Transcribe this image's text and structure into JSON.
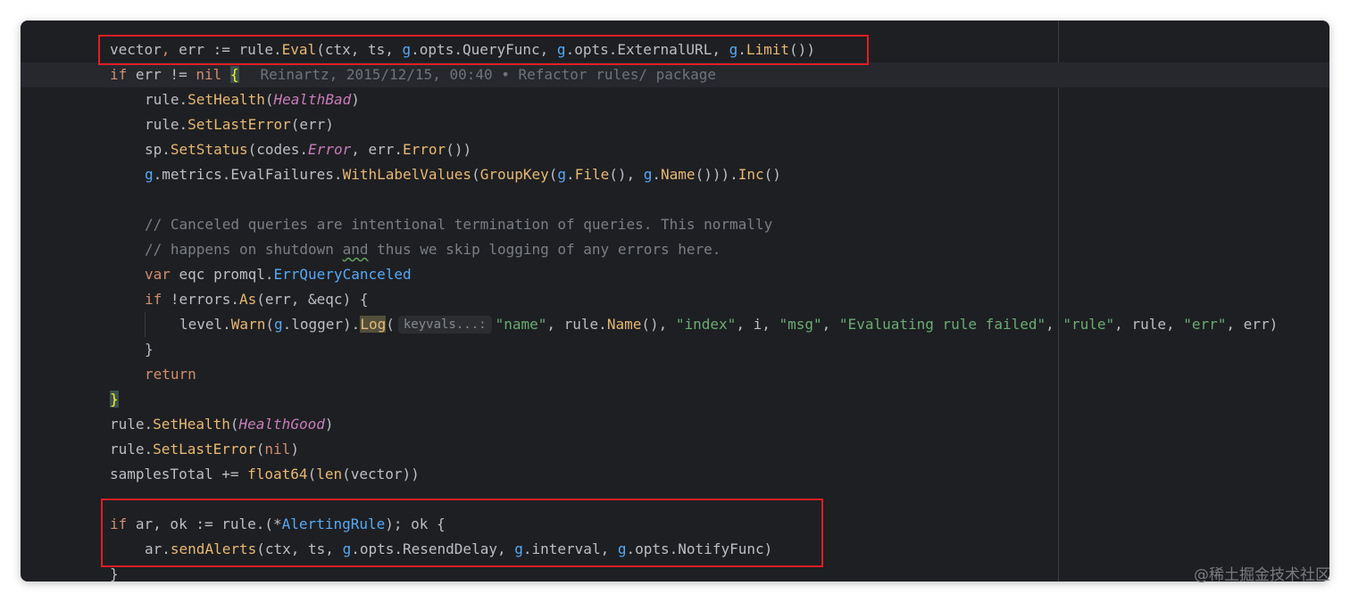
{
  "code": {
    "line1": {
      "t1": "vector",
      "t2": ", ",
      "t3": "err := rule.",
      "t4": "Eval",
      "t5": "(ctx, ts, ",
      "t6": "g",
      "t7": ".opts.QueryFunc, ",
      "t8": "g",
      "t9": ".opts.ExternalURL, ",
      "t10": "g",
      "t11": ".",
      "t12": "Limit",
      "t13": "())"
    },
    "line2": {
      "kw": "if",
      "t1": " err != ",
      "nil": "nil",
      "sp": " ",
      "brace": "{",
      "blame": "Reinartz, 2015/12/15, 00:40 • Refactor rules/ package"
    },
    "line3": {
      "t1": "rule.",
      "fn": "SetHealth",
      "t2": "(",
      "c": "HealthBad",
      "t3": ")"
    },
    "line4": {
      "t1": "rule.",
      "fn": "SetLastError",
      "t2": "(err)"
    },
    "line5": {
      "t1": "sp.",
      "fn": "SetStatus",
      "t2": "(codes.",
      "c": "Error",
      "t3": ", err.",
      "fn2": "Error",
      "t4": "())"
    },
    "line6": {
      "g1": "g",
      "t1": ".metrics.EvalFailures.",
      "fn": "WithLabelValues",
      "t2": "(",
      "fn2": "GroupKey",
      "t3": "(",
      "g2": "g",
      "t4": ".",
      "fn3": "File",
      "t5": "(), ",
      "g3": "g",
      "t6": ".",
      "fn4": "Name",
      "t7": "())).",
      "fn5": "Inc",
      "t8": "()"
    },
    "line8": {
      "cm": "// Canceled queries are intentional termination of queries. This normally"
    },
    "line9": {
      "cm1": "// happens on shutdown ",
      "cm2": "and",
      "cm3": " thus we skip logging of any errors here."
    },
    "line10": {
      "kw": "var",
      "t1": " eqc promql.",
      "fn": "ErrQueryCanceled"
    },
    "line11": {
      "kw": "if",
      "t1": " !errors.",
      "fn": "As",
      "t2": "(err, &eqc) {"
    },
    "line12": {
      "t1": "level.",
      "fn": "Warn",
      "t2": "(",
      "g1": "g",
      "t3": ".logger).",
      "log": "Log",
      "t4": "(",
      "hint": "keyvals...:",
      "s1": "\"name\"",
      "t5": ", rule.",
      "fn2": "Name",
      "t6": "(), ",
      "s2": "\"index\"",
      "t7": ", i, ",
      "s3": "\"msg\"",
      "t8": ", ",
      "s4": "\"Evaluating rule failed\"",
      "t9": ", ",
      "s5": "\"rule\"",
      "t10": ", rule, ",
      "s6": "\"err\"",
      "t11": ", err)"
    },
    "line13": {
      "t1": "}"
    },
    "line14": {
      "kw": "return"
    },
    "line15": {
      "brace": "}"
    },
    "line16": {
      "t1": "rule.",
      "fn": "SetHealth",
      "t2": "(",
      "c": "HealthGood",
      "t3": ")"
    },
    "line17": {
      "t1": "rule.",
      "fn": "SetLastError",
      "t2": "(",
      "nil": "nil",
      "t3": ")"
    },
    "line18": {
      "t1": "samplesTotal += ",
      "fn": "float64",
      "t2": "(",
      "fn2": "len",
      "t3": "(vector))"
    },
    "line20": {
      "kw": "if",
      "t1": " ar, ok := rule.(*",
      "iface": "AlertingRule",
      "t2": "); ok {"
    },
    "line21": {
      "t1": "ar.",
      "fn": "sendAlerts",
      "t2": "(ctx, ts, ",
      "g1": "g",
      "t3": ".opts.ResendDelay, ",
      "g2": "g",
      "t4": ".interval, ",
      "g3": "g",
      "t5": ".opts.NotifyFunc)"
    },
    "line22": {
      "t1": "}"
    }
  },
  "watermark": "@稀土掘金技术社区",
  "colors": {
    "editor_bg": "#1e1f22",
    "highlight_box": "#e01e25",
    "keyword": "#cf8e6d",
    "function": "#56a8f5",
    "string": "#6aab73",
    "comment": "#7a7e85",
    "constant": "#c77dbb"
  }
}
